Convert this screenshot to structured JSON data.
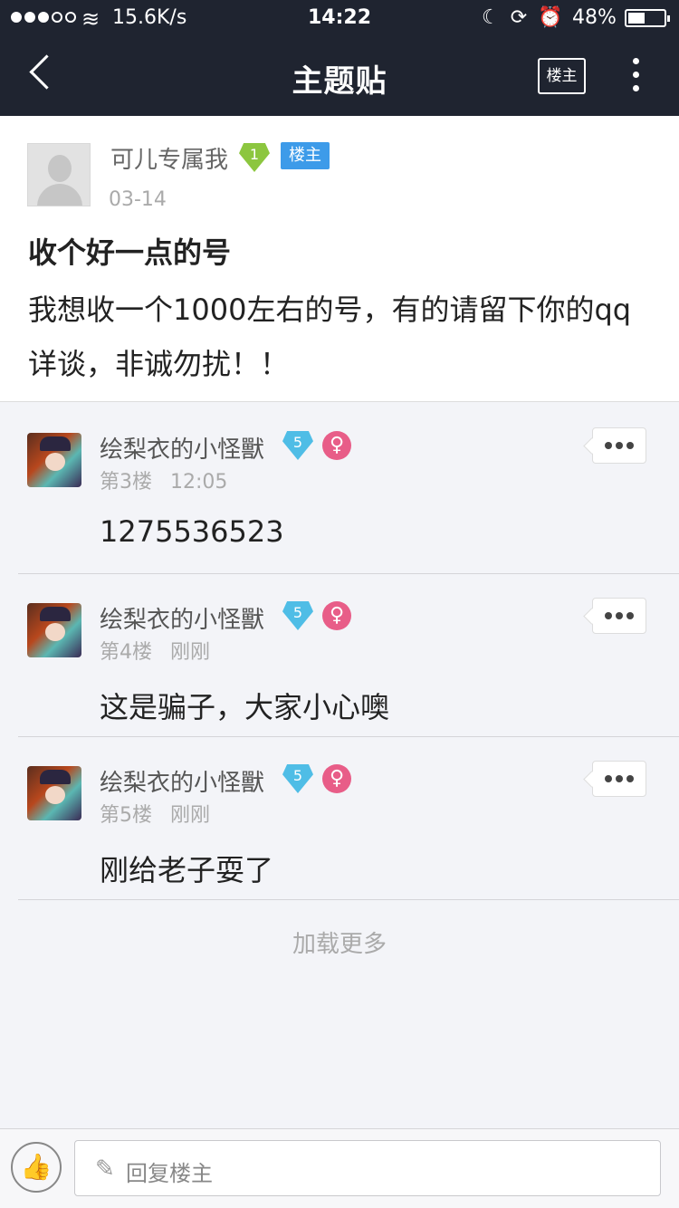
{
  "status_bar": {
    "speed": "15.6K/s",
    "time": "14:22",
    "battery_percent": "48%",
    "battery_level": 0.48
  },
  "nav": {
    "title": "主题贴",
    "op_only_label": "楼主"
  },
  "main_post": {
    "author": "可儿专属我",
    "level": "1",
    "op_tag": "楼主",
    "date": "03-14",
    "title": "收个好一点的号",
    "content": "我想收一个1000左右的号，有的请留下你的qq详谈，非诚勿扰！！"
  },
  "replies": [
    {
      "author": "绘梨衣的小怪獸",
      "level": "5",
      "gender": "♀",
      "floor": "第3楼",
      "time": "12:05",
      "text": "1275536523"
    },
    {
      "author": "绘梨衣的小怪獸",
      "level": "5",
      "gender": "♀",
      "floor": "第4楼",
      "time": "刚刚",
      "text": "这是骗子，大家小心噢"
    },
    {
      "author": "绘梨衣的小怪獸",
      "level": "5",
      "gender": "♀",
      "floor": "第5楼",
      "time": "刚刚",
      "text": "刚给老子耍了"
    }
  ],
  "load_more": "加载更多",
  "bottom_bar": {
    "reply_placeholder": "回复楼主"
  },
  "icons": {
    "back": "chevron-left-icon",
    "more": "more-vertical-icon",
    "like": "thumbs-up-icon",
    "pen": "pencil-icon",
    "gender": "female-icon"
  },
  "colors": {
    "nav_bg": "#1f2430",
    "op_tag": "#3d9be9",
    "level_green": "#8cc63f",
    "level_blue": "#4fbde6",
    "female": "#e85d88"
  }
}
